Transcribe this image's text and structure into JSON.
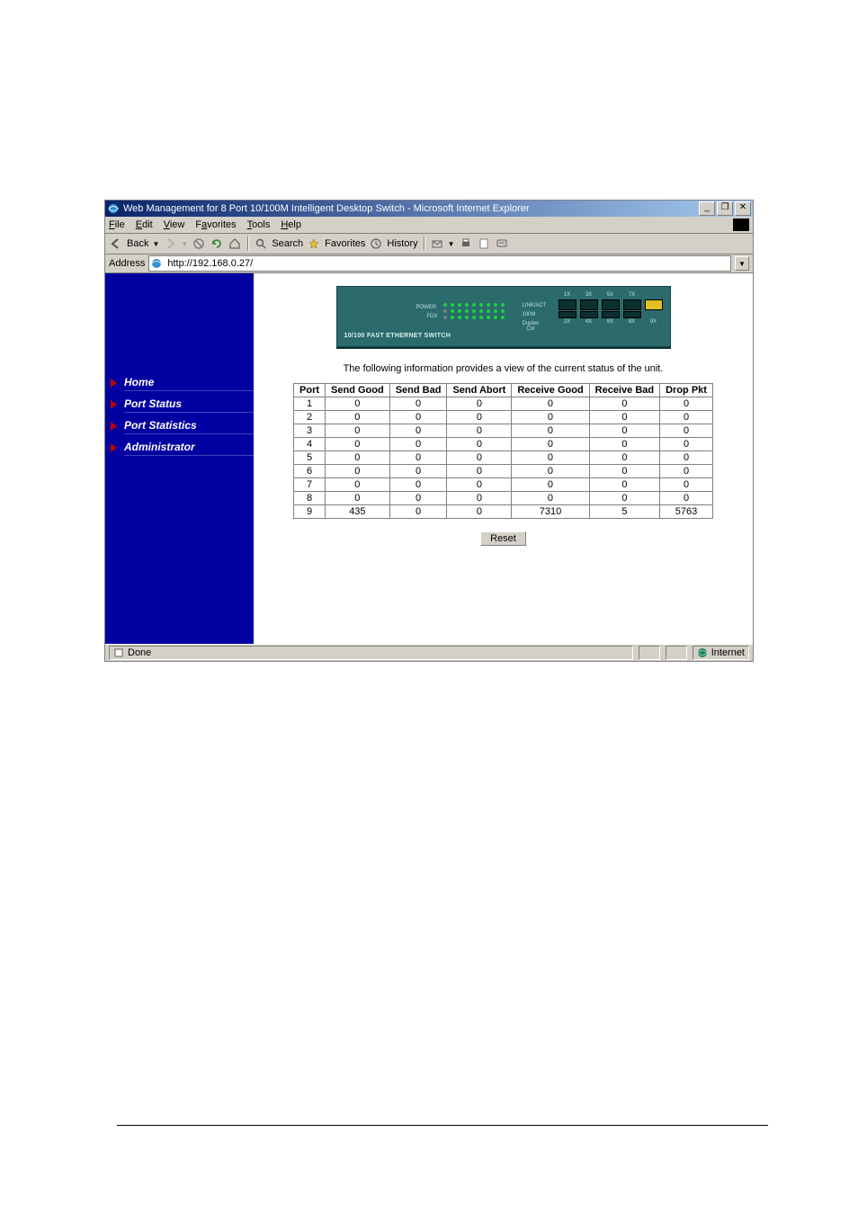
{
  "window": {
    "title": "Web Management for 8 Port 10/100M Intelligent Desktop Switch - Microsoft Internet Explorer",
    "min_label": "_",
    "max_label": "❐",
    "close_label": "✕"
  },
  "menubar": {
    "file": "File",
    "edit": "Edit",
    "view": "View",
    "favorites": "Favorites",
    "tools": "Tools",
    "help": "Help"
  },
  "toolbar": {
    "back": "Back",
    "search": "Search",
    "favorites": "Favorites",
    "history": "History"
  },
  "addressbar": {
    "label": "Address",
    "url": "http://192.168.0.27/"
  },
  "sidebar": {
    "items": [
      {
        "label": "Home"
      },
      {
        "label": "Port Status"
      },
      {
        "label": "Port Statistics"
      },
      {
        "label": "Administrator"
      }
    ]
  },
  "device": {
    "label": "10/100 FAST ETHERNET SWITCH",
    "led_labels": {
      "power": "POWER",
      "fdx": "FDX",
      "lnk": "LINK/ACT",
      "m100": "100M",
      "dup": "Duplex Col"
    },
    "port_top": [
      "1X",
      "3X",
      "5X",
      "7X"
    ],
    "port_bot": [
      "2X",
      "4X",
      "6X",
      "8X",
      "9X"
    ]
  },
  "main": {
    "intro": "The following information provides a view of the current status of the unit.",
    "headers": [
      "Port",
      "Send Good",
      "Send Bad",
      "Send Abort",
      "Receive Good",
      "Receive Bad",
      "Drop Pkt"
    ],
    "rows": [
      {
        "port": "1",
        "send_good": "0",
        "send_bad": "0",
        "send_abort": "0",
        "recv_good": "0",
        "recv_bad": "0",
        "drop_pkt": "0"
      },
      {
        "port": "2",
        "send_good": "0",
        "send_bad": "0",
        "send_abort": "0",
        "recv_good": "0",
        "recv_bad": "0",
        "drop_pkt": "0"
      },
      {
        "port": "3",
        "send_good": "0",
        "send_bad": "0",
        "send_abort": "0",
        "recv_good": "0",
        "recv_bad": "0",
        "drop_pkt": "0"
      },
      {
        "port": "4",
        "send_good": "0",
        "send_bad": "0",
        "send_abort": "0",
        "recv_good": "0",
        "recv_bad": "0",
        "drop_pkt": "0"
      },
      {
        "port": "5",
        "send_good": "0",
        "send_bad": "0",
        "send_abort": "0",
        "recv_good": "0",
        "recv_bad": "0",
        "drop_pkt": "0"
      },
      {
        "port": "6",
        "send_good": "0",
        "send_bad": "0",
        "send_abort": "0",
        "recv_good": "0",
        "recv_bad": "0",
        "drop_pkt": "0"
      },
      {
        "port": "7",
        "send_good": "0",
        "send_bad": "0",
        "send_abort": "0",
        "recv_good": "0",
        "recv_bad": "0",
        "drop_pkt": "0"
      },
      {
        "port": "8",
        "send_good": "0",
        "send_bad": "0",
        "send_abort": "0",
        "recv_good": "0",
        "recv_bad": "0",
        "drop_pkt": "0"
      },
      {
        "port": "9",
        "send_good": "435",
        "send_bad": "0",
        "send_abort": "0",
        "recv_good": "7310",
        "recv_bad": "5",
        "drop_pkt": "5763"
      }
    ],
    "reset_label": "Reset"
  },
  "statusbar": {
    "status": "Done",
    "zone": "Internet"
  }
}
